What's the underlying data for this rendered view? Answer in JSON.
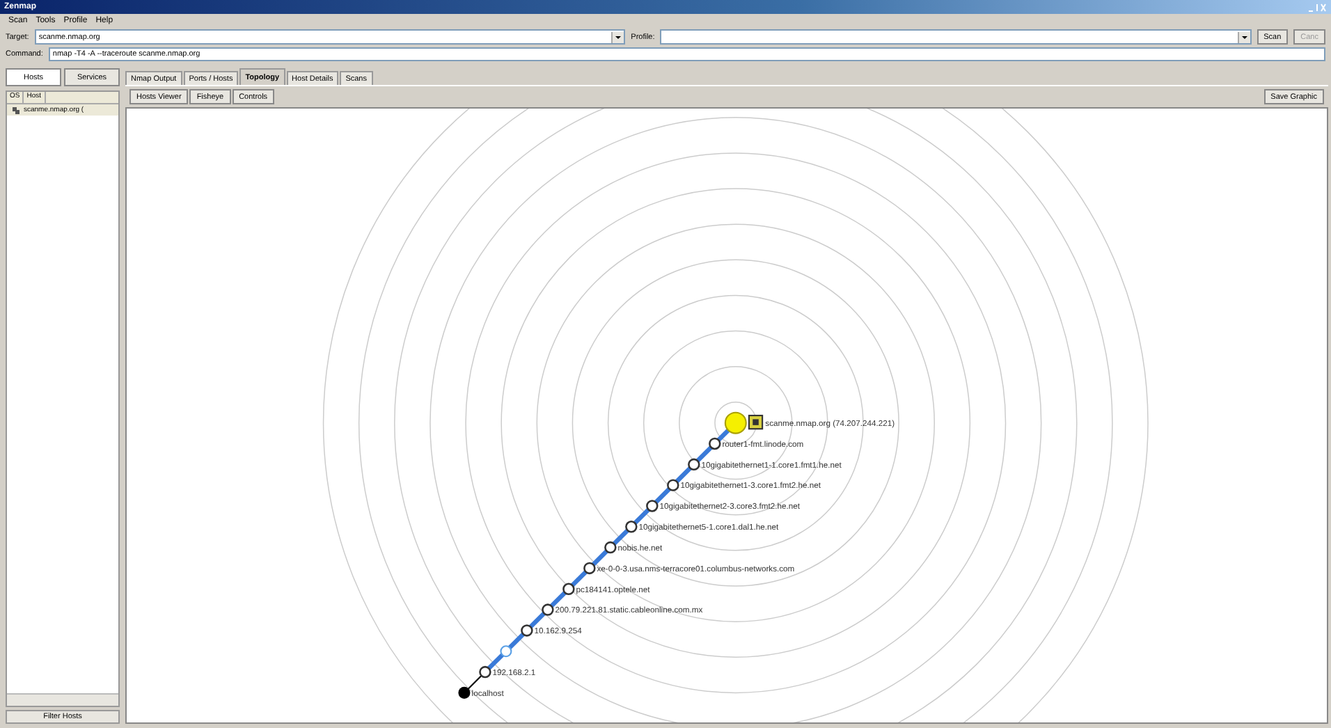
{
  "window": {
    "title": "Zenmap"
  },
  "menu": [
    "Scan",
    "Tools",
    "Profile",
    "Help"
  ],
  "target": {
    "label": "Target:",
    "value": "scanme.nmap.org"
  },
  "profile": {
    "label": "Profile:"
  },
  "buttons": [
    {
      "label": "Scan",
      "disabled": false
    },
    {
      "label": "Canc",
      "disabled": true
    }
  ],
  "command": {
    "label": "Command:",
    "value": "nmap -T4 -A --traceroute scanme.nmap.org"
  },
  "side_tabs": [
    {
      "label": "Hosts",
      "selected": true
    },
    {
      "label": "Services",
      "selected": false
    }
  ],
  "host_list": {
    "columns": [
      "OS",
      "Host"
    ],
    "rows": [
      {
        "host": "scanme.nmap.org ("
      }
    ]
  },
  "filter_button": "Filter Hosts",
  "tabs": [
    {
      "label": "Nmap Output",
      "selected": false
    },
    {
      "label": "Ports / Hosts",
      "selected": false
    },
    {
      "label": "Topology",
      "selected": true
    },
    {
      "label": "Host Details",
      "selected": false
    },
    {
      "label": "Scans",
      "selected": false
    }
  ],
  "topology_buttons": [
    "Hosts Viewer",
    "Fisheye",
    "Controls"
  ],
  "save_button": "Save Graphic",
  "nodes": [
    {
      "kind": "target",
      "label": "scanme.nmap.org (74.207.244.221)"
    },
    {
      "kind": "router",
      "label": "router1-fmt.linode.com"
    },
    {
      "kind": "router",
      "label": "10gigabitethernet1-1.core1.fmt1.he.net"
    },
    {
      "kind": "router",
      "label": "10gigabitethernet1-3.core1.fmt2.he.net"
    },
    {
      "kind": "router",
      "label": "10gigabitethernet2-3.core3.fmt2.he.net"
    },
    {
      "kind": "router",
      "label": "10gigabitethernet5-1.core1.dal1.he.net"
    },
    {
      "kind": "router",
      "label": "nobis.he.net"
    },
    {
      "kind": "router",
      "label": "xe-0-0-3.usa.nms-terracore01.columbus-networks.com"
    },
    {
      "kind": "router",
      "label": "pc184141.optele.net"
    },
    {
      "kind": "router",
      "label": "200.79.221.81.static.cableonline.com.mx"
    },
    {
      "kind": "router",
      "label": "10.162.9.254"
    },
    {
      "kind": "unknown"
    },
    {
      "kind": "router",
      "label": "192.168.2.1"
    },
    {
      "kind": "localhost",
      "label": "localhost"
    }
  ]
}
